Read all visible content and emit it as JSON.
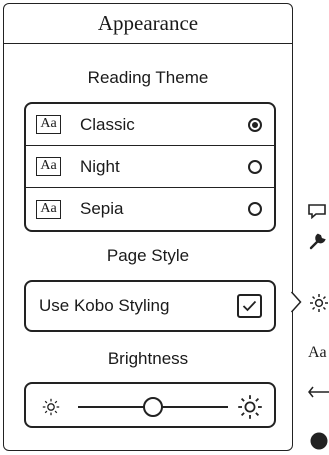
{
  "panel": {
    "title": "Appearance",
    "reading_theme": {
      "heading": "Reading Theme",
      "themes": [
        {
          "badge": "Aa",
          "label": "Classic",
          "selected": true
        },
        {
          "badge": "Aa",
          "label": "Night",
          "selected": false
        },
        {
          "badge": "Aa",
          "label": "Sepia",
          "selected": false
        }
      ]
    },
    "page_style": {
      "heading": "Page Style",
      "option_label": "Use Kobo Styling",
      "checked": true
    },
    "brightness": {
      "heading": "Brightness",
      "level": 0.5,
      "min_icon": "sun-small-icon",
      "max_icon": "sun-large-icon"
    }
  },
  "side_toolbar": {
    "items": [
      {
        "icon": "comment-icon"
      },
      {
        "icon": "wrench-icon"
      },
      {
        "icon": "brightness-icon",
        "active": true
      },
      {
        "icon": "font-icon",
        "text": "Aa"
      },
      {
        "icon": "width-icon"
      },
      {
        "icon": "circle-icon"
      }
    ]
  }
}
